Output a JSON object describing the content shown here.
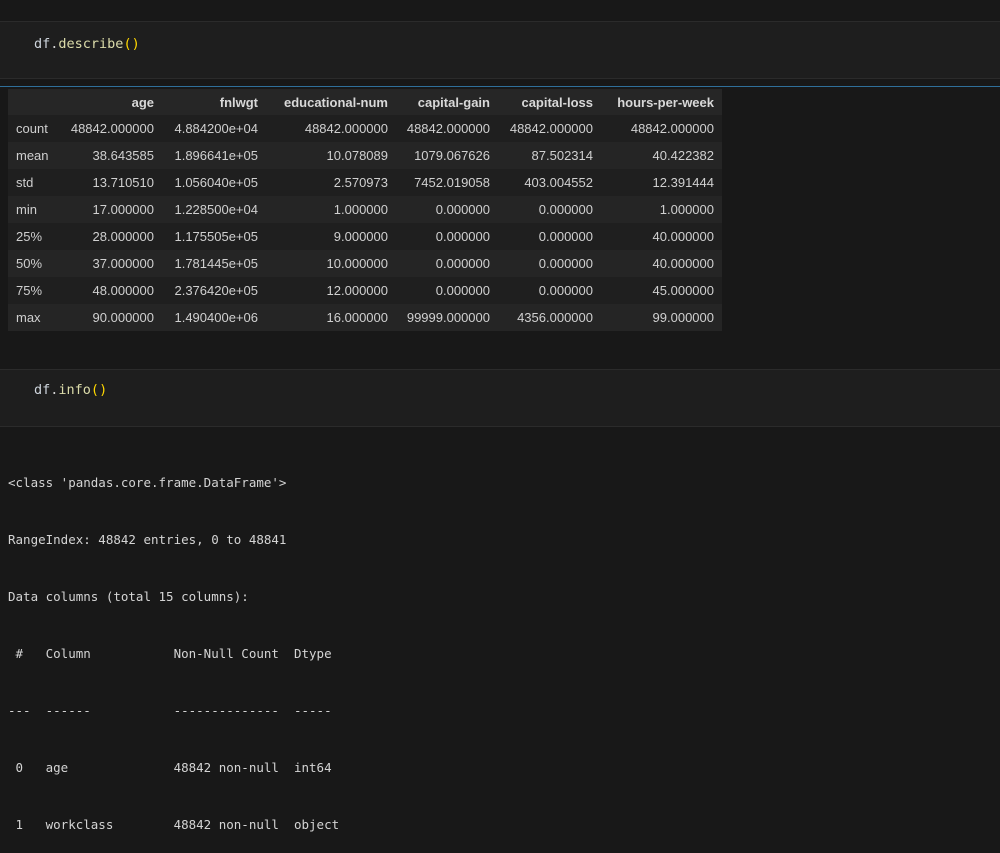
{
  "cells": [
    {
      "code": {
        "var": "df",
        "dot": ".",
        "fn": "describe",
        "open": "(",
        "close": ")"
      }
    },
    {
      "code": {
        "var": "df",
        "dot": ".",
        "fn": "info",
        "open": "(",
        "close": ")"
      }
    }
  ],
  "describe": {
    "columns": [
      "",
      "age",
      "fnlwgt",
      "educational-num",
      "capital-gain",
      "capital-loss",
      "hours-per-week"
    ],
    "rows": [
      {
        "label": "count",
        "values": [
          "48842.000000",
          "4.884200e+04",
          "48842.000000",
          "48842.000000",
          "48842.000000",
          "48842.000000"
        ]
      },
      {
        "label": "mean",
        "values": [
          "38.643585",
          "1.896641e+05",
          "10.078089",
          "1079.067626",
          "87.502314",
          "40.422382"
        ]
      },
      {
        "label": "std",
        "values": [
          "13.710510",
          "1.056040e+05",
          "2.570973",
          "7452.019058",
          "403.004552",
          "12.391444"
        ]
      },
      {
        "label": "min",
        "values": [
          "17.000000",
          "1.228500e+04",
          "1.000000",
          "0.000000",
          "0.000000",
          "1.000000"
        ]
      },
      {
        "label": "25%",
        "values": [
          "28.000000",
          "1.175505e+05",
          "9.000000",
          "0.000000",
          "0.000000",
          "40.000000"
        ]
      },
      {
        "label": "50%",
        "values": [
          "37.000000",
          "1.781445e+05",
          "10.000000",
          "0.000000",
          "0.000000",
          "40.000000"
        ]
      },
      {
        "label": "75%",
        "values": [
          "48.000000",
          "2.376420e+05",
          "12.000000",
          "0.000000",
          "0.000000",
          "45.000000"
        ]
      },
      {
        "label": "max",
        "values": [
          "90.000000",
          "1.490400e+06",
          "16.000000",
          "99999.000000",
          "4356.000000",
          "99.000000"
        ]
      }
    ]
  },
  "info": {
    "lines": [
      "<class 'pandas.core.frame.DataFrame'>",
      "RangeIndex: 48842 entries, 0 to 48841",
      "Data columns (total 15 columns):",
      " #   Column           Non-Null Count  Dtype ",
      "---  ------           --------------  ----- ",
      " 0   age              48842 non-null  int64 ",
      " 1   workclass        48842 non-null  object"
    ]
  },
  "colors": {
    "background": "#181818",
    "cell_background": "#1e1e1e",
    "output_accent": "#2f6f9a",
    "function_token": "#dcdcaa",
    "paren_token": "#ffd700"
  }
}
